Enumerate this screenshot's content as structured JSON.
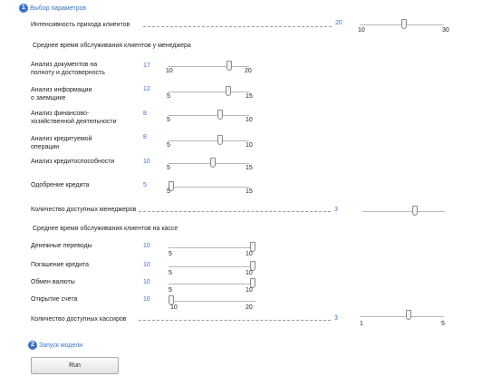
{
  "section1": {
    "number": "1",
    "title": "Выбор параметров"
  },
  "intensity": {
    "label": "Интенсивность прихода клиентов",
    "value": "20",
    "min": "10",
    "max": "30"
  },
  "managers_header": "Среднее время обслуживания клиентов у менеджера",
  "managers": [
    {
      "label": "Анализ документов на\nполноту и достоверность",
      "value": "17",
      "min": "10",
      "max": "20"
    },
    {
      "label": "Анализ информации\nо заемщике",
      "value": "12",
      "min": "5",
      "max": "15"
    },
    {
      "label": "Анализ финансово-\nхозяйственной деятельности",
      "value": "8",
      "min": "5",
      "max": "10"
    },
    {
      "label": "Анализ кредитуемой\nоперации",
      "value": "8",
      "min": "5",
      "max": "10"
    },
    {
      "label": "Анализ кредитоспособности",
      "value": "10",
      "min": "5",
      "max": "15"
    },
    {
      "label": "Одобрение кредита",
      "value": "5",
      "min": "5",
      "max": "15"
    }
  ],
  "managers_count": {
    "label": "Количество доступных менеджеров",
    "value": "3"
  },
  "cashier_header": "Среднее время обслуживания клиентов на кассе",
  "cashier": [
    {
      "label": "Денежные переводы",
      "value": "10",
      "min": "5",
      "max": "10"
    },
    {
      "label": "Погашение кредита",
      "value": "10",
      "min": "5",
      "max": "10"
    },
    {
      "label": "Обмен валюты",
      "value": "10",
      "min": "5",
      "max": "10"
    },
    {
      "label": "Открытие счета",
      "value": "10",
      "min": "10",
      "max": "20"
    }
  ],
  "cashiers_count": {
    "label": "Количество доступных кассиров",
    "value": "3",
    "min": "1",
    "max": "5"
  },
  "section2": {
    "number": "2",
    "title": "Запуск модели"
  },
  "run_label": "Run"
}
